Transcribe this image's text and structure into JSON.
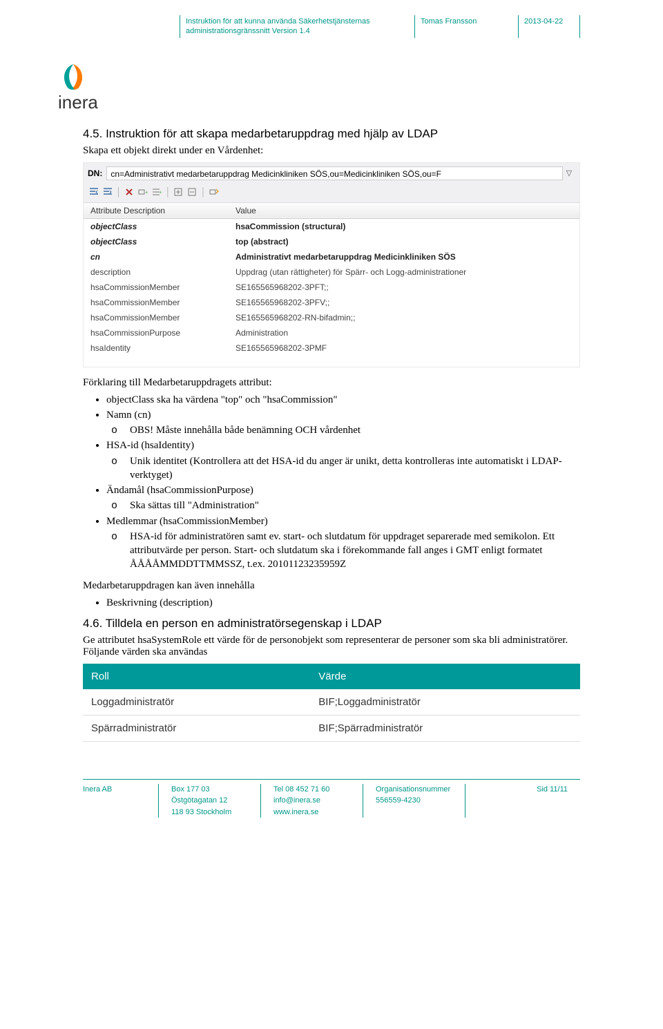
{
  "header": {
    "doc_title_l1": "Instruktion för att kunna använda Säkerhetstjänsternas",
    "doc_title_l2": "administrationsgränssnitt Version 1.4",
    "author": "Tomas Fransson",
    "date": "2013-04-22"
  },
  "logo": {
    "name": "inera"
  },
  "section45": {
    "heading": "4.5.   Instruktion för att skapa medarbetaruppdrag med hjälp av LDAP",
    "intro": "Skapa ett objekt direkt under en Vårdenhet:"
  },
  "ldap_shot": {
    "dn_label": "DN:",
    "dn_value": "cn=Administrativt medarbetaruppdrag Medicinkliniken SÖS,ou=Medicinkliniken SÖS,ou=F",
    "cols": {
      "attr": "Attribute Description",
      "value": "Value"
    },
    "rows": [
      {
        "attr": "objectClass",
        "value": "hsaCommission (structural)",
        "style": "bold"
      },
      {
        "attr": "objectClass",
        "value": "top (abstract)",
        "style": "bold"
      },
      {
        "attr": "cn",
        "value": "Administrativt medarbetaruppdrag Medicinkliniken SÖS",
        "style": "bold italic"
      },
      {
        "attr": "description",
        "value": "Uppdrag (utan rättigheter) för Spärr- och Logg-administrationer"
      },
      {
        "attr": "hsaCommissionMember",
        "value": "SE165565968202-3PFT;;"
      },
      {
        "attr": "hsaCommissionMember",
        "value": "SE165565968202-3PFV;;"
      },
      {
        "attr": "hsaCommissionMember",
        "value": "SE165565968202-RN-bifadmin;;"
      },
      {
        "attr": "hsaCommissionPurpose",
        "value": "Administration"
      },
      {
        "attr": "hsaIdentity",
        "value": "SE165565968202-3PMF"
      }
    ]
  },
  "explain": {
    "intro": "Förklaring till Medarbetaruppdragets attribut:",
    "b1": "objectClass ska ha värdena \"top\" och \"hsaCommission\"",
    "b2": "Namn (cn)",
    "b2a": "OBS! Måste innehålla både benämning OCH vårdenhet",
    "b3": "HSA-id (hsaIdentity)",
    "b3a": "Unik identitet (Kontrollera att det HSA-id du anger är unikt, detta kontrolleras inte automatiskt i LDAP-verktyget)",
    "b4": "Ändamål (hsaCommissionPurpose)",
    "b4a": "Ska sättas till \"Administration\"",
    "b5": "Medlemmar (hsaCommissionMember)",
    "b5a": "HSA-id för administratören samt ev. start- och slutdatum för uppdraget separerade med semikolon. Ett attributvärde per person. Start- och slutdatum ska i förekommande fall anges i GMT enligt formatet ÅÅÅÅMMDDTTMMSSZ, t.ex. 20101123235959Z",
    "also_intro": "Medarbetaruppdragen kan även innehålla",
    "also_1": "Beskrivning (description)"
  },
  "section46": {
    "heading": "4.6.   Tilldela en person en administratörsegenskap i LDAP",
    "para": "Ge attributet hsaSystemRole ett värde för de personobjekt som representerar de personer som ska bli administratörer. Följande värden ska användas",
    "th1": "Roll",
    "th2": "Värde",
    "rows": [
      {
        "role": "Loggadministratör",
        "value": "BIF;Loggadministratör"
      },
      {
        "role": "Spärradministratör",
        "value": "BIF;Spärradministratör"
      }
    ]
  },
  "footer": {
    "company": "Inera AB",
    "addr1": "Box 177 03",
    "addr2": "Östgötagatan 12",
    "addr3": "118 93 Stockholm",
    "tel": "Tel 08 452 71 60",
    "email": "info@inera.se",
    "web": "www.inera.se",
    "org_lbl": "Organisationsnummer",
    "org_val": "556559-4230",
    "page": "Sid 11/11"
  }
}
